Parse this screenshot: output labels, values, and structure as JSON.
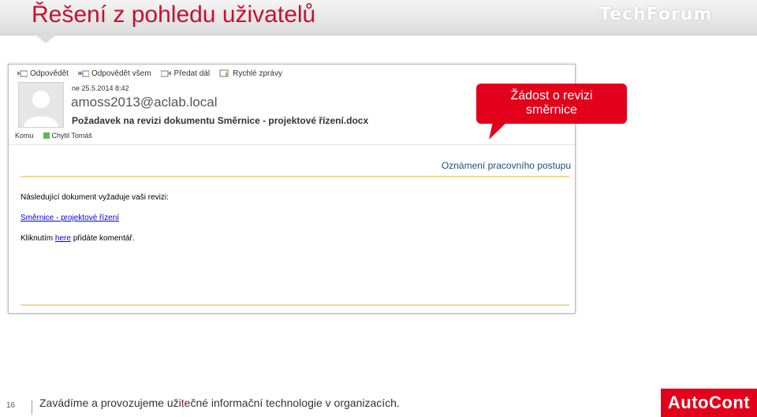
{
  "slide": {
    "title": "Řešení z pohledu uživatelů",
    "logo_text": "TechForum",
    "number": "16"
  },
  "email": {
    "toolbar": [
      {
        "label": "Odpovědět",
        "icon": "reply-icon"
      },
      {
        "label": "Odpovědět všem",
        "icon": "reply-all-icon"
      },
      {
        "label": "Předat dál",
        "icon": "forward-icon"
      },
      {
        "label": "Rychlé zprávy",
        "icon": "quick-steps-icon"
      }
    ],
    "date": "ne 25.5.2014 8:42",
    "sender": "amoss2013@aclab.local",
    "subject": "Požadavek na revizi dokumentu Směrnice - projektové řízení.docx",
    "to_label": "Komu",
    "recipient": "Chytil Tomáš",
    "announcement": "Oznámení pracovního postupu",
    "body_intro": "Následující dokument vyžaduje vaši revizi:",
    "doc_link": "Směrnice - projektové řízení",
    "comment_prefix": "Kliknutím",
    "comment_link": "here",
    "comment_suffix": "přidáte komentář."
  },
  "callout": {
    "line1": "Žádost o revizi",
    "line2": "směrnice",
    "color": "#e3001b"
  },
  "footer": {
    "text_before": "Zavádíme a provozujeme uži",
    "text_highlight": "t",
    "text_after": "ečné informační technologie v organizacích.",
    "logo_text": "AutoCont"
  }
}
